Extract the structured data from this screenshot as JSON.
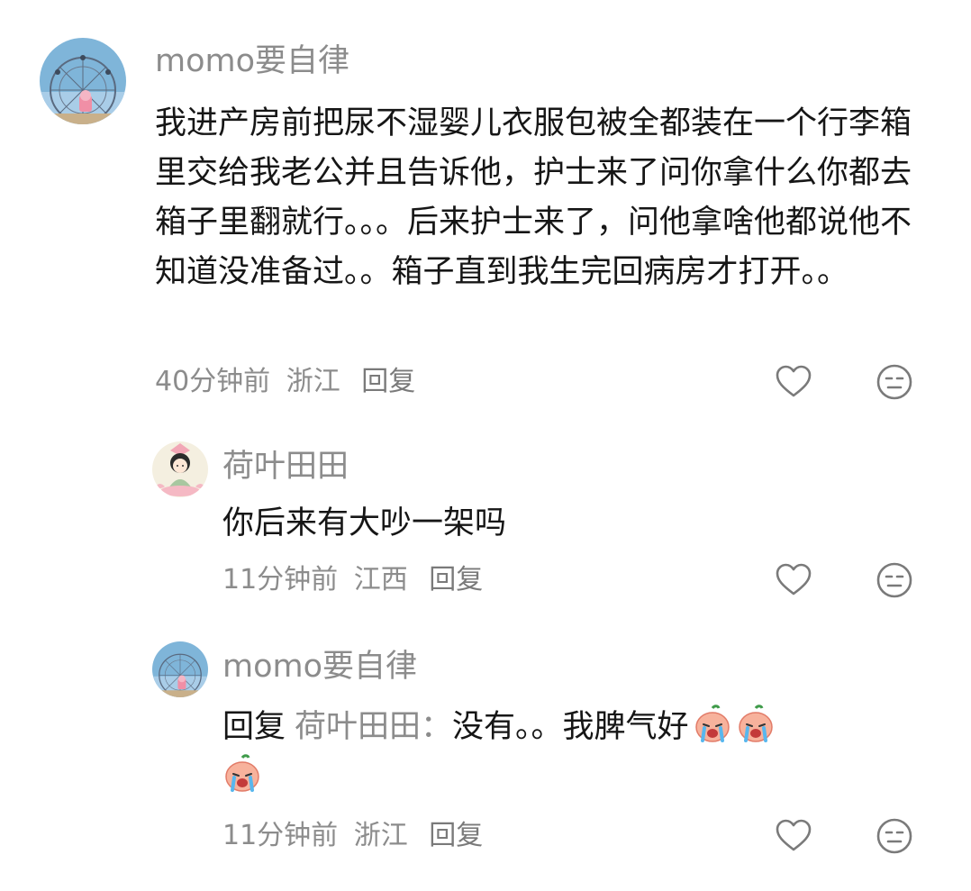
{
  "comments": [
    {
      "username": "momo要自律",
      "text": "我进产房前把尿不湿婴儿衣服包被全都装在一个行李箱里交给我老公并且告诉他，护士来了问你拿什么你都去箱子里翻就行。。。后来护士来了，问他拿啥他都说他不知道没准备过。。箱子直到我生完回病房才打开。。",
      "time": "40分钟前",
      "location": "浙江",
      "reply_label": "回复"
    },
    {
      "username": "荷叶田田",
      "text": "你后来有大吵一架吗",
      "time": "11分钟前",
      "location": "江西",
      "reply_label": "回复"
    },
    {
      "username": "momo要自律",
      "reply_prefix": "回复",
      "reply_to": "荷叶田田：",
      "text": "没有。。我脾气好",
      "emojis": [
        "crying-peach-emoji",
        "crying-peach-emoji",
        "crying-peach-emoji"
      ],
      "time": "11分钟前",
      "location": "浙江",
      "reply_label": "回复"
    }
  ],
  "icons": {
    "like": "heart-outline-icon",
    "dislike": "neutral-face-icon"
  },
  "colors": {
    "text_primary": "#161616",
    "text_secondary": "#8c8c8c",
    "icon": "#7a7a7a"
  }
}
